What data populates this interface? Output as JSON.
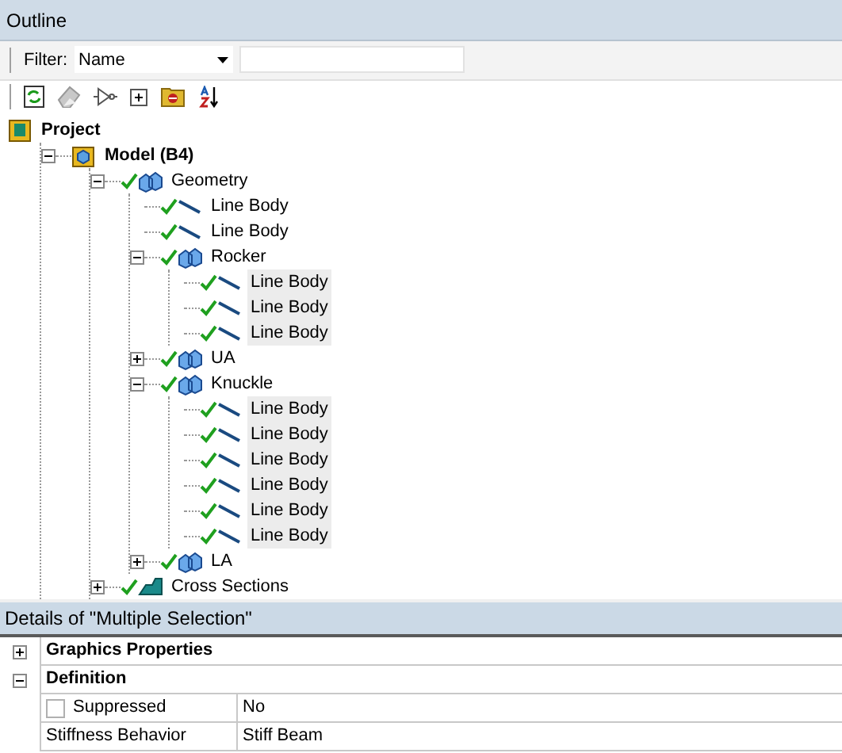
{
  "outline": {
    "title": "Outline",
    "filter": {
      "label": "Filter:",
      "value": "Name"
    },
    "tree": [
      {
        "kind": "project",
        "label": "Project",
        "children": [
          {
            "kind": "model",
            "label": "Model (B4)",
            "expanded": true,
            "children": [
              {
                "kind": "geometry",
                "label": "Geometry",
                "expanded": true,
                "children": [
                  {
                    "kind": "line",
                    "label": "Line Body",
                    "selected": false
                  },
                  {
                    "kind": "line",
                    "label": "Line Body",
                    "selected": false
                  },
                  {
                    "kind": "part",
                    "label": "Rocker",
                    "expanded": true,
                    "children": [
                      {
                        "kind": "line",
                        "label": "Line Body",
                        "selected": true
                      },
                      {
                        "kind": "line",
                        "label": "Line Body",
                        "selected": true
                      },
                      {
                        "kind": "line",
                        "label": "Line Body",
                        "selected": true
                      }
                    ]
                  },
                  {
                    "kind": "part",
                    "label": "UA",
                    "expanded": false
                  },
                  {
                    "kind": "part",
                    "label": "Knuckle",
                    "expanded": true,
                    "children": [
                      {
                        "kind": "line",
                        "label": "Line Body",
                        "selected": true
                      },
                      {
                        "kind": "line",
                        "label": "Line Body",
                        "selected": true
                      },
                      {
                        "kind": "line",
                        "label": "Line Body",
                        "selected": true
                      },
                      {
                        "kind": "line",
                        "label": "Line Body",
                        "selected": true
                      },
                      {
                        "kind": "line",
                        "label": "Line Body",
                        "selected": true
                      },
                      {
                        "kind": "line",
                        "label": "Line Body",
                        "selected": true
                      }
                    ]
                  },
                  {
                    "kind": "part",
                    "label": "LA",
                    "expanded": false
                  }
                ]
              },
              {
                "kind": "sections",
                "label": "Cross Sections",
                "expanded": false
              }
            ]
          }
        ]
      }
    ]
  },
  "details": {
    "title": "Details of \"Multiple Selection\"",
    "rows": [
      {
        "kind": "group",
        "label": "Graphics Properties",
        "expanded": false
      },
      {
        "kind": "group",
        "label": "Definition",
        "expanded": true
      },
      {
        "kind": "checkbox",
        "label": "Suppressed",
        "checked": false,
        "value": "No"
      },
      {
        "kind": "field",
        "label": "Stiffness Behavior",
        "value": "Stiff Beam"
      }
    ]
  }
}
